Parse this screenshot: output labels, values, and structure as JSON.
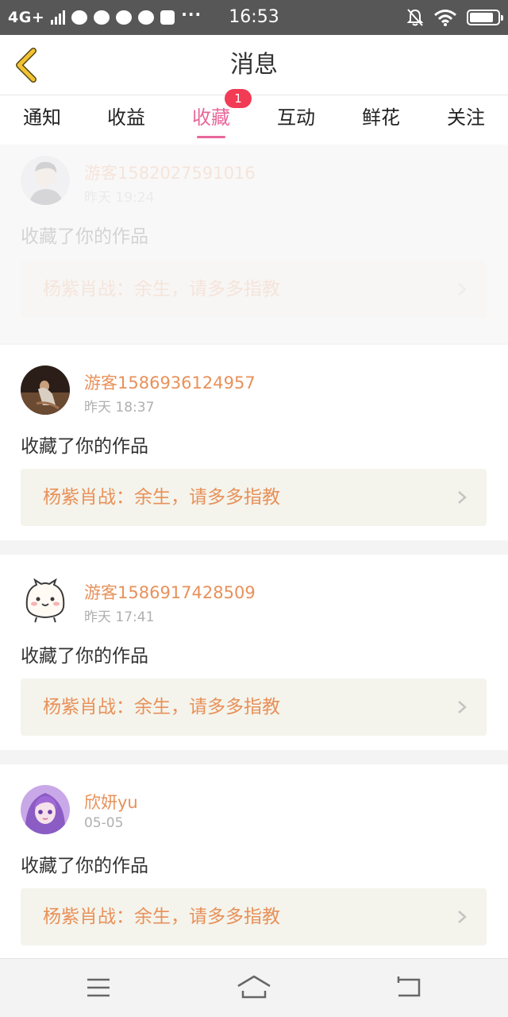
{
  "status_bar": {
    "network": "4G+",
    "more": "···",
    "time": "16:53",
    "battery_level": 0.85
  },
  "header": {
    "title": "消息"
  },
  "tabs": [
    {
      "label": "通知"
    },
    {
      "label": "收益"
    },
    {
      "label": "收藏",
      "badge": "1",
      "active": true
    },
    {
      "label": "互动"
    },
    {
      "label": "鲜花"
    },
    {
      "label": "关注"
    }
  ],
  "messages": [
    {
      "user": "游客1582027591016",
      "time": "昨天 19:24",
      "action": "收藏了你的作品",
      "work_title": "杨紫肖战：余生，请多多指教",
      "avatar": "man-photo",
      "faded": true
    },
    {
      "user": "游客1586936124957",
      "time": "昨天 18:37",
      "action": "收藏了你的作品",
      "work_title": "杨紫肖战：余生，请多多指教",
      "avatar": "dark-photo"
    },
    {
      "user": "游客1586917428509",
      "time": "昨天 17:41",
      "action": "收藏了你的作品",
      "work_title": "杨紫肖战：余生，请多多指教",
      "avatar": "cartoon-cat"
    },
    {
      "user": "欣妍yu",
      "time": "05-05",
      "action": "收藏了你的作品",
      "work_title": "杨紫肖战：余生，请多多指教",
      "avatar": "anime-girl"
    }
  ],
  "colors": {
    "accent_pink": "#e8679a",
    "accent_orange": "#e8915a",
    "badge_red": "#f23b54",
    "back_arrow_yellow": "#f1c232"
  }
}
